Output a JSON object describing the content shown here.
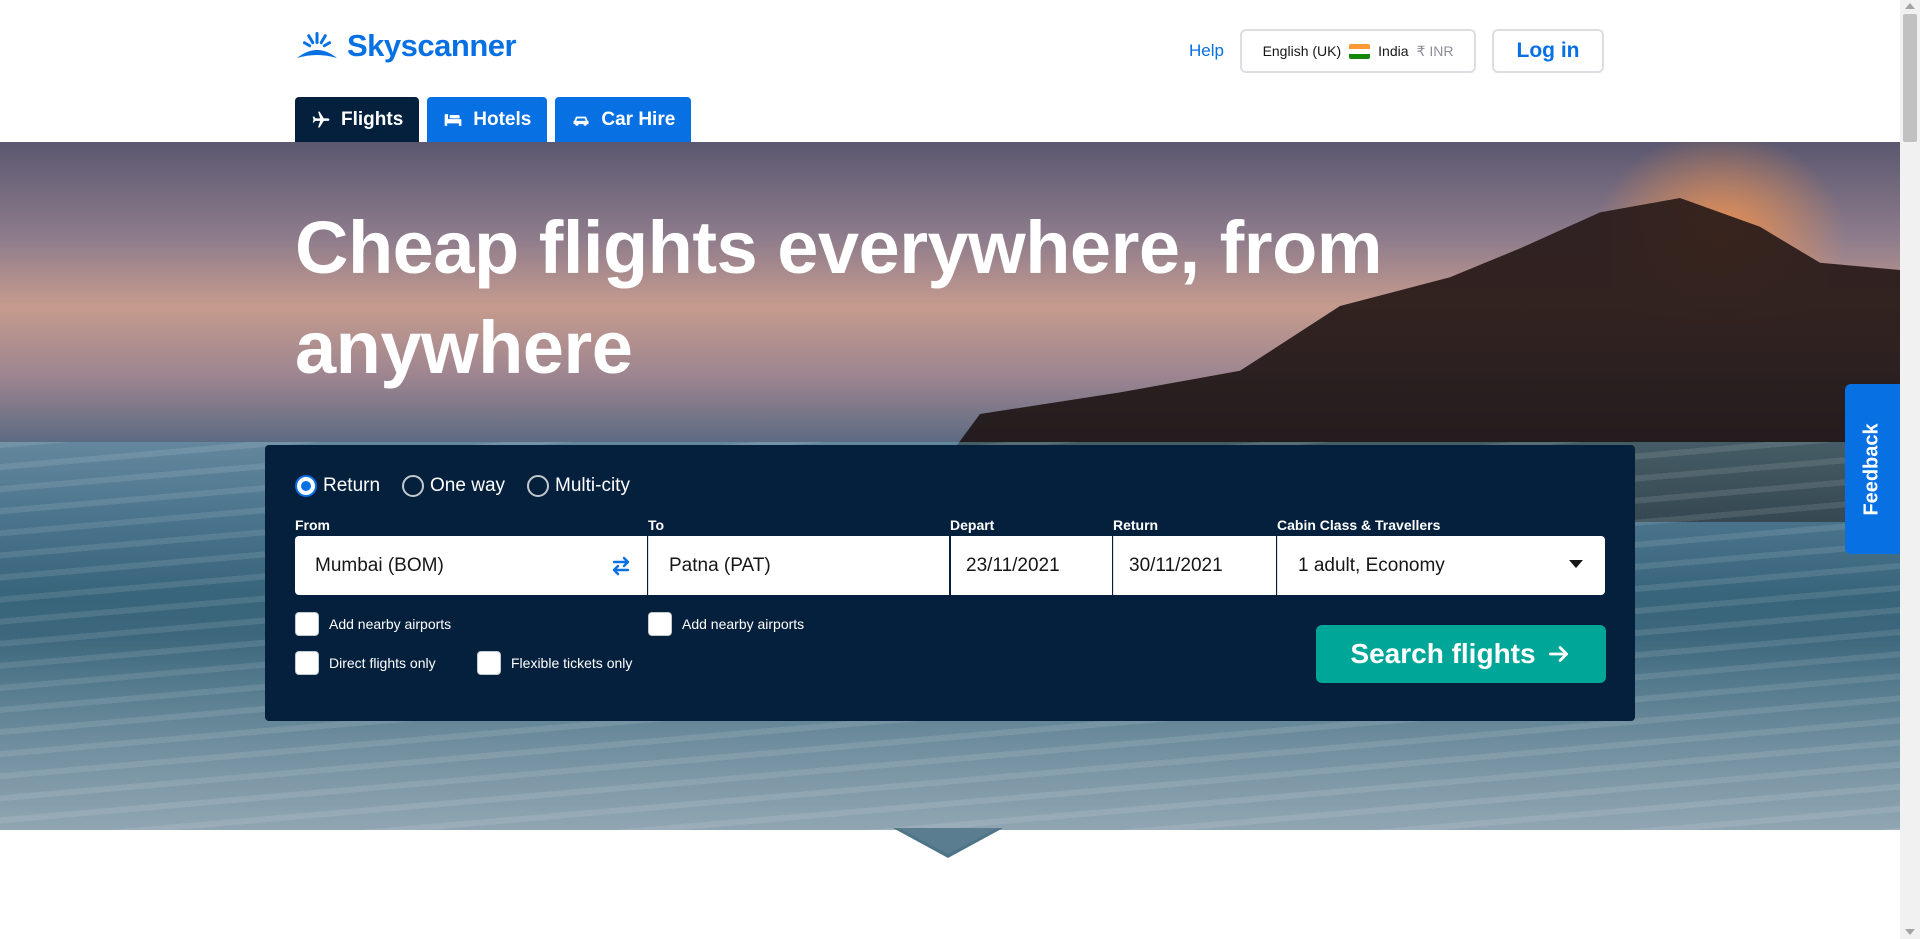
{
  "brand": {
    "name": "Skyscanner",
    "color": "#0770e3",
    "dark": "#05203c",
    "accent": "#00a698"
  },
  "header": {
    "help_label": "Help",
    "locale": {
      "language": "English (UK)",
      "country": "India",
      "currency": "₹ INR",
      "flag_icon": "india-flag-icon"
    },
    "login_label": "Log in"
  },
  "tabs": [
    {
      "label": "Flights",
      "icon": "plane-icon",
      "active": true
    },
    {
      "label": "Hotels",
      "icon": "bed-icon",
      "active": false
    },
    {
      "label": "Car Hire",
      "icon": "car-icon",
      "active": false
    }
  ],
  "hero": {
    "title": "Cheap flights everywhere, from anywhere"
  },
  "feedback_label": "Feedback",
  "search": {
    "trip_types": [
      {
        "label": "Return",
        "checked": true
      },
      {
        "label": "One way",
        "checked": false
      },
      {
        "label": "Multi-city",
        "checked": false
      }
    ],
    "from": {
      "label": "From",
      "value": "Mumbai (BOM)"
    },
    "to": {
      "label": "To",
      "value": "Patna (PAT)"
    },
    "depart": {
      "label": "Depart",
      "value": "23/11/2021"
    },
    "return": {
      "label": "Return",
      "value": "30/11/2021"
    },
    "cabin": {
      "label": "Cabin Class & Travellers",
      "value": "1 adult, Economy"
    },
    "options": {
      "nearby_from": "Add nearby airports",
      "nearby_to": "Add nearby airports",
      "direct_only": "Direct flights only",
      "flexible": "Flexible tickets only"
    },
    "submit_label": "Search flights"
  }
}
